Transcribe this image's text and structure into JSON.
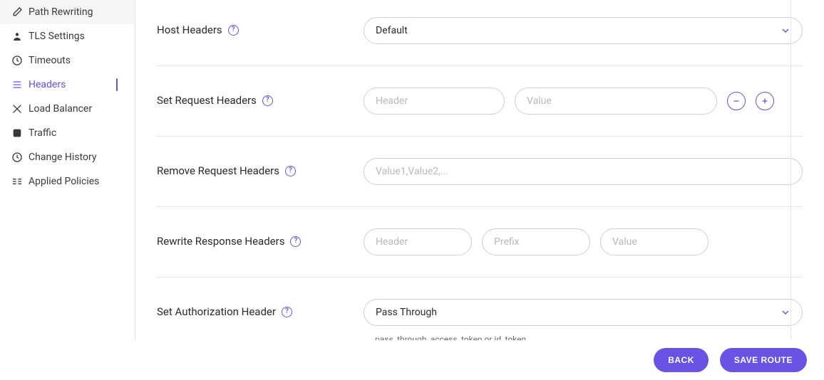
{
  "sidebar": {
    "items": [
      {
        "label": "Path Rewriting"
      },
      {
        "label": "TLS Settings"
      },
      {
        "label": "Timeouts"
      },
      {
        "label": "Headers"
      },
      {
        "label": "Load Balancer"
      },
      {
        "label": "Traffic"
      },
      {
        "label": "Change History"
      },
      {
        "label": "Applied Policies"
      }
    ]
  },
  "form": {
    "host_headers": {
      "label": "Host Headers",
      "value": "Default"
    },
    "set_request_headers": {
      "label": "Set Request Headers",
      "header_placeholder": "Header",
      "value_placeholder": "Value"
    },
    "remove_request_headers": {
      "label": "Remove Request Headers",
      "placeholder": "Value1,Value2,..."
    },
    "rewrite_response_headers": {
      "label": "Rewrite Response Headers",
      "header_placeholder": "Header",
      "prefix_placeholder": "Prefix",
      "value_placeholder": "Value"
    },
    "set_auth_header": {
      "label": "Set Authorization Header",
      "value": "Pass Through",
      "hint": "pass_through, access_token or id_token"
    }
  },
  "footer": {
    "back": "BACK",
    "save": "SAVE ROUTE"
  }
}
